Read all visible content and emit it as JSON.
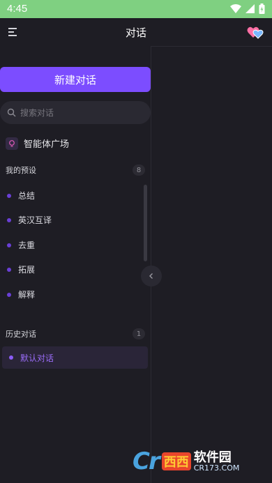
{
  "status_bar": {
    "time": "4:45",
    "icons": [
      "wifi-icon",
      "signal-icon",
      "battery-icon"
    ]
  },
  "header": {
    "title": "对话",
    "left_icon": "menu-icon",
    "right_icon": "heart-icon"
  },
  "sidebar": {
    "new_chat_label": "新建对话",
    "search": {
      "placeholder": "搜索对话",
      "value": ""
    },
    "agent_plaza_label": "智能体广场",
    "presets": {
      "title": "我的预设",
      "count": "8",
      "items": [
        {
          "label": "总结"
        },
        {
          "label": "英汉互译"
        },
        {
          "label": "去重"
        },
        {
          "label": "拓展"
        },
        {
          "label": "解释"
        }
      ]
    },
    "history": {
      "title": "历史对话",
      "count": "1",
      "items": [
        {
          "label": "默认对话",
          "selected": true
        }
      ]
    }
  },
  "watermark": {
    "logo": "Cr",
    "highlight": "西西",
    "name": "软件园",
    "site": "CR173.COM"
  },
  "colors": {
    "accent": "#7c4dff",
    "background": "#1e1d24",
    "status_bar": "#7fd081"
  }
}
